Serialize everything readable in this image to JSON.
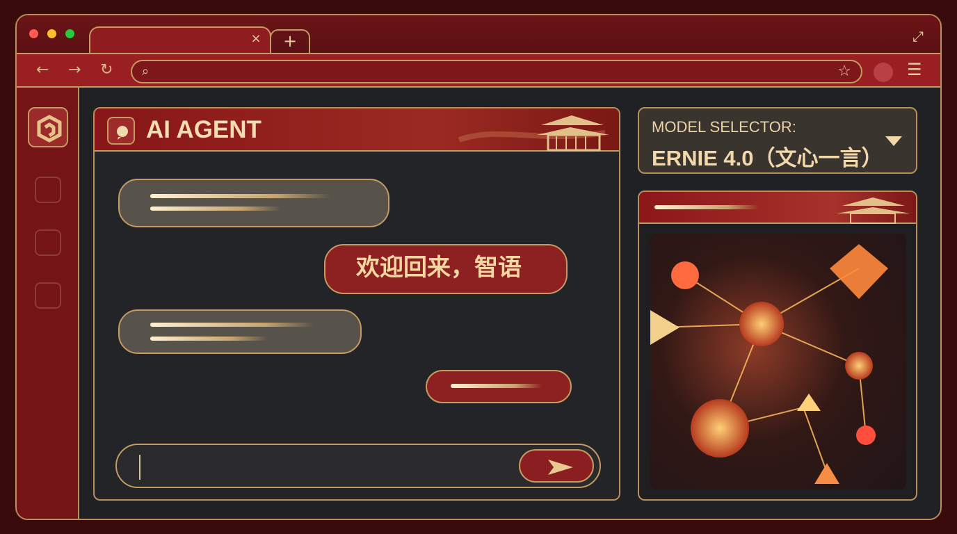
{
  "browser": {
    "close_tab_label": "×",
    "new_tab_label": "+",
    "expand_label": "⤢",
    "back_label": "←",
    "forward_label": "→",
    "reload_label": "↻",
    "search_label": "⌕",
    "favorite_label": "☆",
    "menu_label": "☰"
  },
  "chat": {
    "title": "AI AGENT",
    "welcome_message": "欢迎回来，智语"
  },
  "model_selector": {
    "label": "MODEL SELECTOR:",
    "value": "ERNIE 4.0（文心一言）"
  },
  "icons": {
    "chat": "chat-bubble-icon",
    "send": "send-icon",
    "sidebar_active": "hexagon-logo-icon"
  },
  "colors": {
    "frame": "#5a1013",
    "accent": "#c59a63",
    "panel": "#222427",
    "outgoing_bubble": "#8d2020"
  }
}
